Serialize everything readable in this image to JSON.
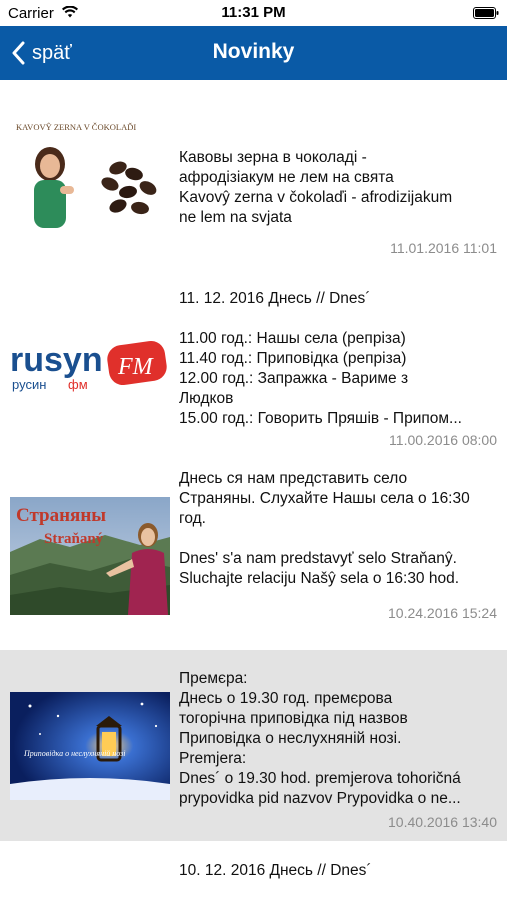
{
  "status": {
    "carrier": "Carrier",
    "time": "11:31 PM"
  },
  "navbar": {
    "back_label": "späť",
    "title": "Novinky"
  },
  "items": [
    {
      "thumb_caption": "KAVOVŶ ZERNA V ČOKOLAĎI",
      "lines": [
        "Кавовы зерна в чоколаді -",
        "афродізіакум не лем на свята",
        "Kavovŷ zerna v čokolaďi - afrodizijakum",
        "ne lem na svjata"
      ],
      "date": "11.01.2016 11:01"
    },
    {
      "headline": "11. 12. 2016 Днесь // Dnes´",
      "logo_main": "rusyn",
      "logo_sub": "русин",
      "logo_fm_cyr": "фм",
      "logo_fm": "FM",
      "lines": [
        "11.00 год.: Нашы села (репріза)",
        "11.40 год.: Приповідка (репріза)",
        "12.00 год.: Запражка - Вариме з",
        "Людков",
        "15.00 год.: Говорить Пряшів - Припом..."
      ],
      "date": "11.00.2016 08:00"
    },
    {
      "thumb_title_cyr": "Страняны",
      "thumb_title_lat": "Straňaný",
      "lines_a": [
        "Днесь ся нам представить село",
        "Страняны. Слухайте Нашы села о 16:30",
        "год."
      ],
      "lines_b": [
        "Dnes' s'a nam predstavyť selo Straňanŷ.",
        "Sluchajte relaciju Našŷ sela o 16:30 hod."
      ],
      "date": "10.24.2016 15:24"
    },
    {
      "thumb_caption": "Приповідка о неслухняній нозі",
      "lines": [
        "Премєра:",
        "Днесь о 19.30 год. премєрова",
        "тогорічна приповідка під назвов",
        "Приповідка о неслухняній нозі.",
        "Premjera:",
        "Dnes´ o 19.30 hod. premjerova tohoričná",
        "prypovidka pid nazvov Prypovidka o ne..."
      ],
      "date": "10.40.2016 13:40"
    },
    {
      "headline": "10. 12. 2016 Днесь // Dnes´"
    }
  ],
  "colors": {
    "navbar": "#0a5aa6",
    "highlight_row": "#e3e3e3",
    "date_text": "#8c8c8c",
    "logo_blue": "#1a4f8f",
    "logo_red": "#e0302b"
  }
}
